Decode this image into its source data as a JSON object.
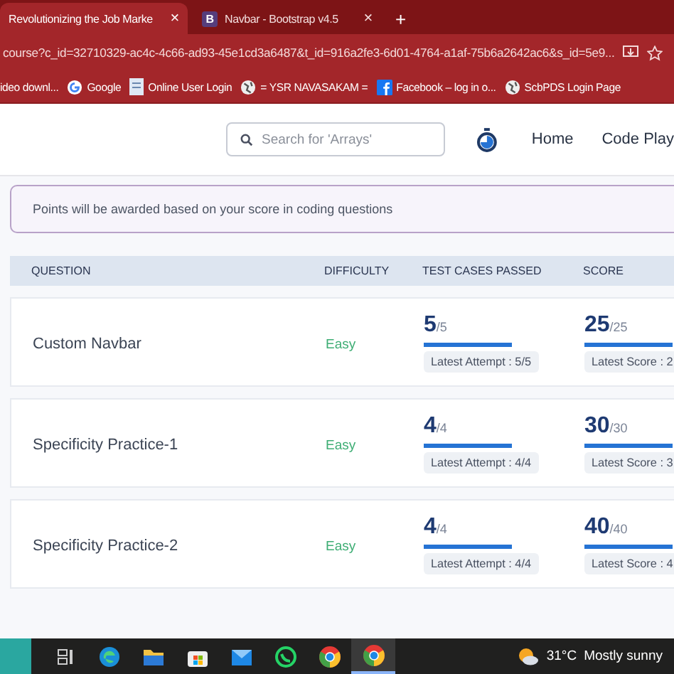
{
  "browser": {
    "tabs": [
      {
        "title": "Revolutionizing the Job Marke",
        "close": "×",
        "selected": true
      },
      {
        "icon_text": "B",
        "title": "Navbar - Bootstrap v4.5",
        "close": "×",
        "selected": false
      }
    ],
    "new_tab": "+",
    "address": "course?c_id=32710329-ac4c-4c66-ad93-45e1cd3a6487&t_id=916a2fe3-6d01-4764-a1af-75b6a2642ac6&s_id=5e9...",
    "bookmarks": [
      {
        "kind": "none",
        "label": "ideo downl..."
      },
      {
        "kind": "google",
        "label": "Google"
      },
      {
        "kind": "doc",
        "label": "Online User Login"
      },
      {
        "kind": "globe",
        "label": "= YSR NAVASAKAM ="
      },
      {
        "kind": "facebook",
        "label": "Facebook – log in o..."
      },
      {
        "kind": "globe",
        "label": "ScbPDS Login Page"
      }
    ]
  },
  "navbar": {
    "search": {
      "placeholder": "Search for 'Arrays'"
    },
    "links": [
      "Home",
      "Code Play"
    ]
  },
  "notice": "Points will be awarded based on your score in coding questions",
  "table": {
    "columns": [
      "QUESTION",
      "DIFFICULTY",
      "TEST CASES PASSED",
      "SCORE"
    ],
    "rows": [
      {
        "question": "Custom Navbar",
        "difficulty": "Easy",
        "color": "#3fae75",
        "tests": {
          "value": "5",
          "total": "/5",
          "level": 1,
          "note": "Latest Attempt : 5/5"
        },
        "score": {
          "value": "25",
          "total": "/25",
          "level": 1,
          "note": "Latest Score : 2"
        }
      },
      {
        "question": "Specificity Practice-1",
        "difficulty": "Easy",
        "color": "#3fae75",
        "tests": {
          "value": "4",
          "total": "/4",
          "level": 1,
          "note": "Latest Attempt : 4/4"
        },
        "score": {
          "value": "30",
          "total": "/30",
          "level": 1,
          "note": "Latest Score : 3"
        }
      },
      {
        "question": "Specificity Practice-2",
        "difficulty": "Easy",
        "color": "#3fae75",
        "tests": {
          "value": "4",
          "total": "/4",
          "level": 1,
          "note": "Latest Attempt : 4/4"
        },
        "score": {
          "value": "40",
          "total": "/40",
          "level": 1,
          "note": "Latest Score : 4"
        }
      }
    ]
  },
  "taskbar": {
    "apps": [
      {
        "kind": "taskview",
        "selected": false
      },
      {
        "kind": "edge",
        "selected": false
      },
      {
        "kind": "folder",
        "selected": false
      },
      {
        "kind": "store",
        "selected": false
      },
      {
        "kind": "mail",
        "selected": false
      },
      {
        "kind": "whatsapp",
        "selected": false
      },
      {
        "kind": "chrome",
        "selected": false
      },
      {
        "kind": "chrome",
        "selected": true
      }
    ],
    "temperature": "31°C",
    "weather": "Mostly sunny"
  }
}
